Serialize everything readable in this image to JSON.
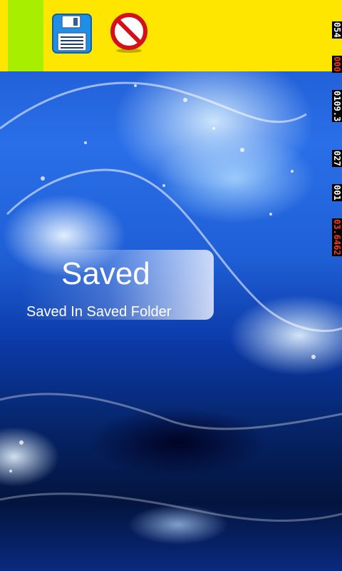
{
  "toolbar": {
    "color_swatch": "#a8ee00",
    "background_color": "#ffe600",
    "save_icon": "floppy-disk-icon",
    "cancel_icon": "prohibited-icon"
  },
  "counters": [
    "054",
    "000",
    "0109.3",
    "027",
    "001",
    "03.6462"
  ],
  "toast": {
    "title": "Saved",
    "message": "Saved In Saved Folder"
  }
}
